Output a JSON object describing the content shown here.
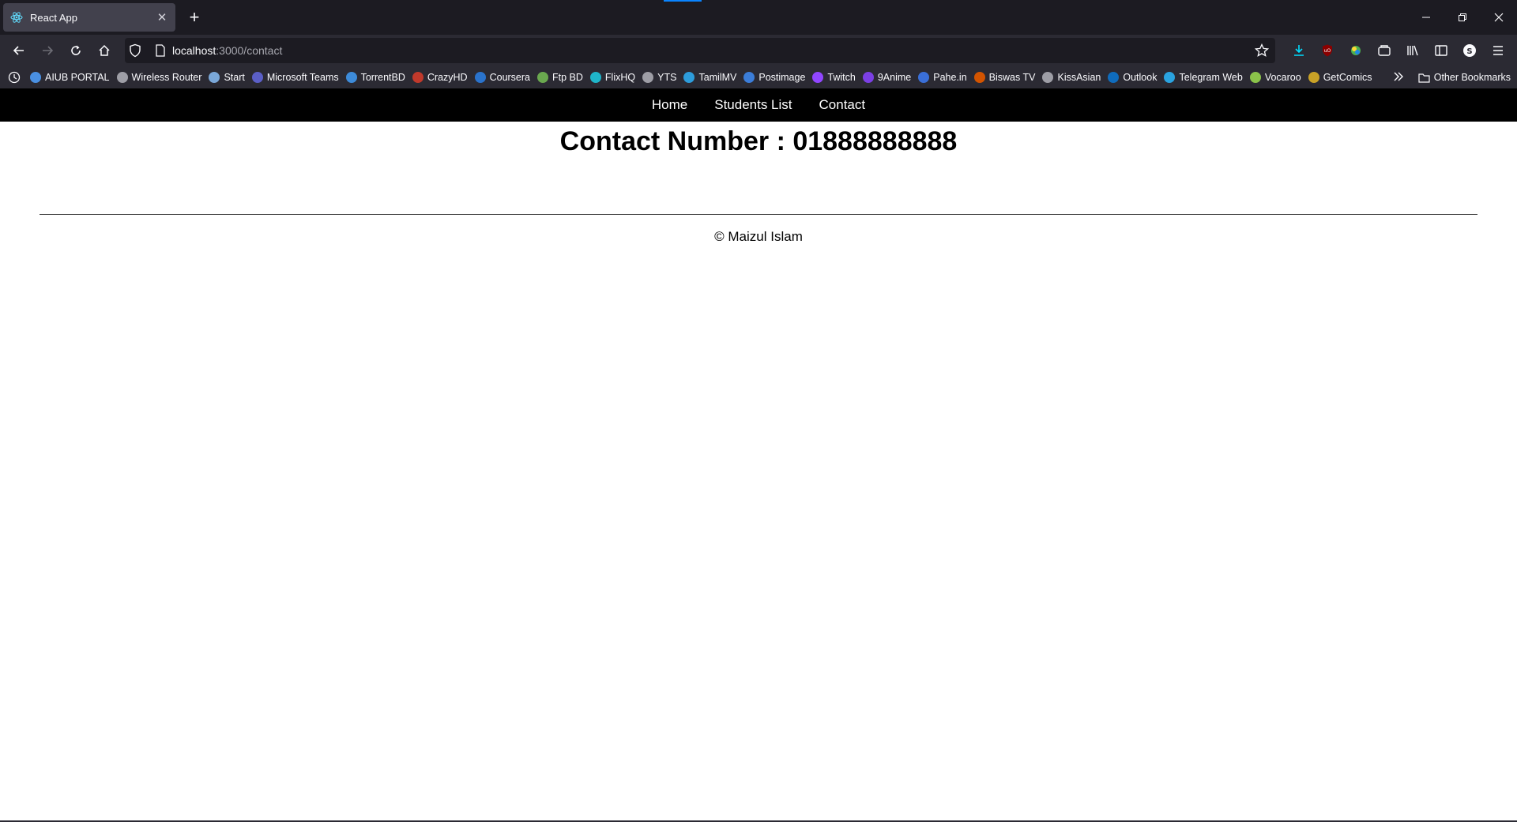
{
  "browser": {
    "tab_title": "React App",
    "url_host": "localhost",
    "url_rest": ":3000/contact",
    "bookmarks": [
      {
        "label": "AIUB PORTAL",
        "icon": "shield-icon",
        "color": "#4a90e2"
      },
      {
        "label": "Wireless Router",
        "icon": "globe-icon",
        "color": "#9e9ea6"
      },
      {
        "label": "Start",
        "icon": "shield-icon",
        "color": "#7aa7d8"
      },
      {
        "label": "Microsoft Teams",
        "icon": "teams-icon",
        "color": "#5b5fc7"
      },
      {
        "label": "TorrentBD",
        "icon": "torrentbd-icon",
        "color": "#3d8bd9"
      },
      {
        "label": "CrazyHD",
        "icon": "crazyhd-icon",
        "color": "#c0392b"
      },
      {
        "label": "Coursera",
        "icon": "coursera-icon",
        "color": "#2a73cc"
      },
      {
        "label": "Ftp BD",
        "icon": "ftpbd-icon",
        "color": "#6aa84f"
      },
      {
        "label": "FlixHQ",
        "icon": "flixhq-icon",
        "color": "#1fb5c9"
      },
      {
        "label": "YTS",
        "icon": "globe-icon",
        "color": "#9e9ea6"
      },
      {
        "label": "TamilMV",
        "icon": "tamilmv-icon",
        "color": "#2d9cdb"
      },
      {
        "label": "Postimage",
        "icon": "postimage-icon",
        "color": "#3b7dd8"
      },
      {
        "label": "Twitch",
        "icon": "twitch-icon",
        "color": "#9146ff"
      },
      {
        "label": "9Anime",
        "icon": "play-icon",
        "color": "#7b3fe4"
      },
      {
        "label": "Pahe.in",
        "icon": "pahe-icon",
        "color": "#3a6fd8"
      },
      {
        "label": "Biswas TV",
        "icon": "biswastv-icon",
        "color": "#d35400"
      },
      {
        "label": "KissAsian",
        "icon": "globe-icon",
        "color": "#9e9ea6"
      },
      {
        "label": "Outlook",
        "icon": "outlook-icon",
        "color": "#0f6cbd"
      },
      {
        "label": "Telegram Web",
        "icon": "telegram-icon",
        "color": "#2aa3e0"
      },
      {
        "label": "Vocaroo",
        "icon": "vocaroo-icon",
        "color": "#8bc34a"
      },
      {
        "label": "GetComics",
        "icon": "getcomics-icon",
        "color": "#c9a227"
      }
    ],
    "other_bookmarks": "Other Bookmarks"
  },
  "site_nav": {
    "items": [
      "Home",
      "Students List",
      "Contact"
    ]
  },
  "main": {
    "heading": "Contact Number : 01888888888"
  },
  "footer": {
    "text": "© Maizul Islam"
  }
}
